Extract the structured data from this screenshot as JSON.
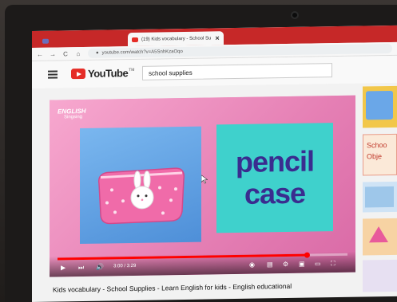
{
  "browser": {
    "tabs": [
      {
        "label": "",
        "active": false
      },
      {
        "label": "(19) Kids vocabulary - School Su",
        "active": true,
        "close": "✕"
      }
    ],
    "url": "youtube.com/watch?v=A5SnhKzaOqo",
    "nav": {
      "back": "←",
      "forward": "→",
      "reload": "C",
      "home": "⌂"
    }
  },
  "youtube": {
    "logo_text": "YouTube",
    "logo_tm": "TM",
    "search_value": "school supplies"
  },
  "video": {
    "channel_logo_line1": "ENGLISH",
    "channel_logo_line2": "Singsing",
    "word_line1": "pencil",
    "word_line2": "case",
    "time": "3:00 / 3:29",
    "progress_fraction": 0.86,
    "title": "Kids vocabulary - School Supplies - Learn English for kids - English educational"
  },
  "sidebar": {
    "thumb2_text_line1": "Schoo",
    "thumb2_text_line2": "Obje"
  },
  "colors": {
    "brand_red": "#e52d27",
    "tab_strip": "#c62828",
    "word_color": "#3a2c8f",
    "panel_teal": "#3fd1cc"
  }
}
